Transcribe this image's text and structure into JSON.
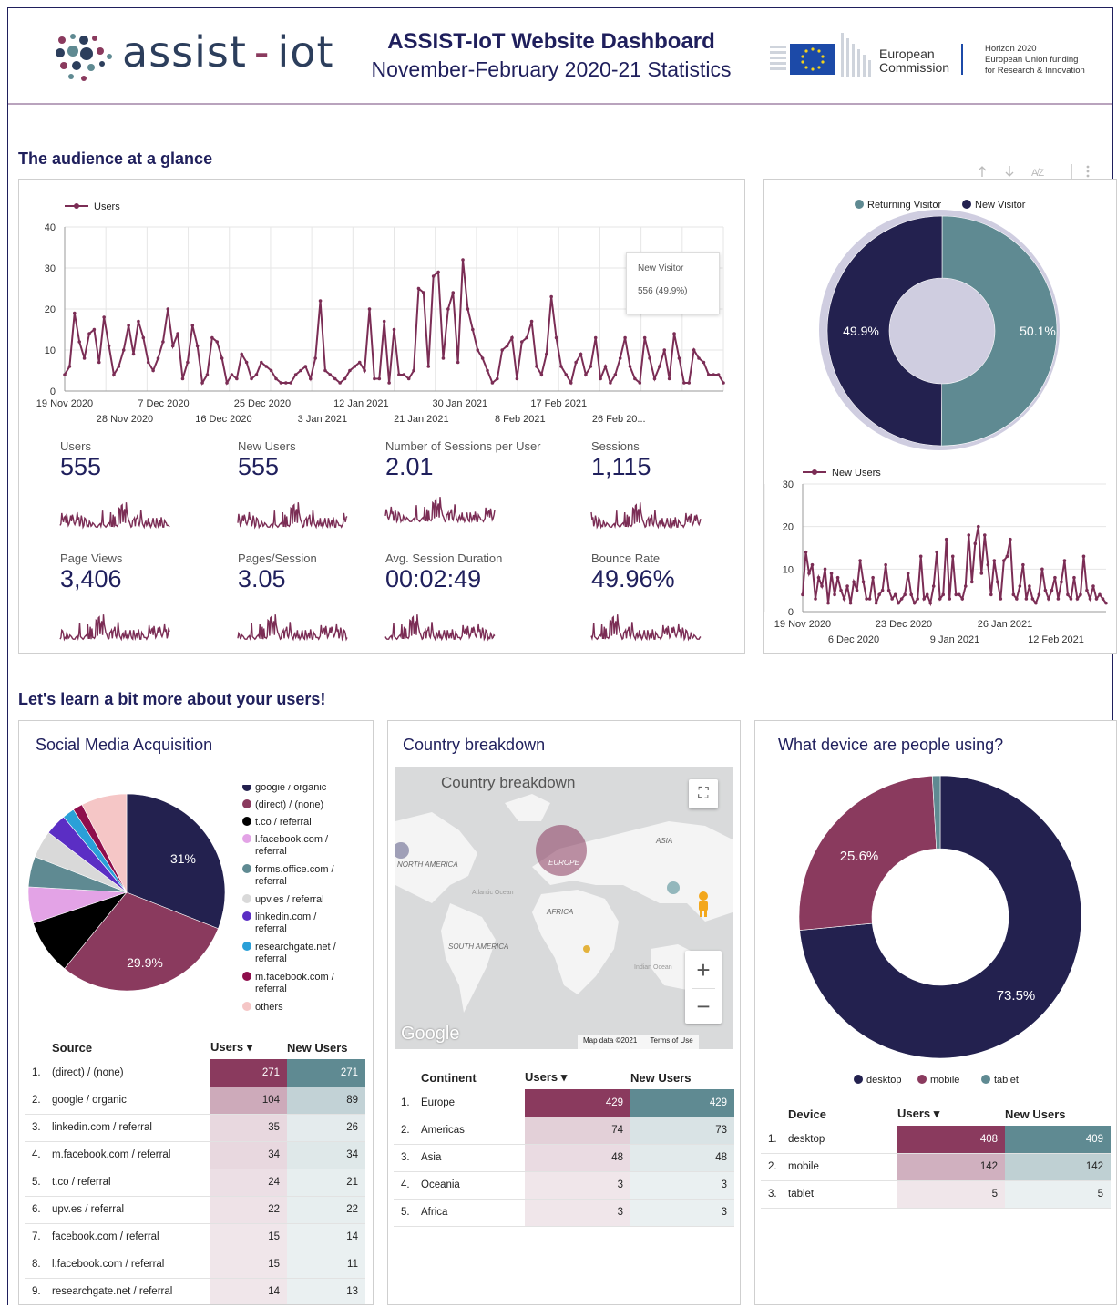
{
  "header": {
    "logo_text_main": "assist",
    "logo_dash": "-",
    "logo_text_end": "iot",
    "title": "ASSIST-IoT Website Dashboard",
    "subtitle": "November-February 2020-21 Statistics",
    "ec_line1": "European",
    "ec_line2": "Commission",
    "horizon_line1": "Horizon 2020",
    "horizon_line2": "European Union funding",
    "horizon_line3": "for Research & Innovation"
  },
  "section1": {
    "title": "The audience at a glance"
  },
  "section2": {
    "title": "Let's learn a bit more about your users!"
  },
  "users_chart": {
    "legend": "Users",
    "tooltip_title": "New Visitor",
    "tooltip_value": "556 (49.9%)",
    "x_ticks_top": [
      "19 Nov 2020",
      "7 Dec 2020",
      "25 Dec 2020",
      "12 Jan 2021",
      "30 Jan 2021",
      "17 Feb 2021"
    ],
    "x_ticks_bottom": [
      "28 Nov 2020",
      "16 Dec 2020",
      "3 Jan 2021",
      "21 Jan 2021",
      "8 Feb 2021",
      "26 Feb 20..."
    ],
    "y_ticks": [
      "0",
      "10",
      "20",
      "30",
      "40"
    ]
  },
  "kpis": [
    {
      "label": "Users",
      "value": "555"
    },
    {
      "label": "New Users",
      "value": "555"
    },
    {
      "label": "Number of Sessions per User",
      "value": "2.01"
    },
    {
      "label": "Sessions",
      "value": "1,115"
    },
    {
      "label": "Page Views",
      "value": "3,406"
    },
    {
      "label": "Pages/Session",
      "value": "3.05"
    },
    {
      "label": "Avg. Session Duration",
      "value": "00:02:49"
    },
    {
      "label": "Bounce Rate",
      "value": "49.96%"
    }
  ],
  "visitor_donut": {
    "legend": [
      "Returning Visitor",
      "New Visitor"
    ],
    "colors": [
      "#5f8a92",
      "#23214f"
    ],
    "values": [
      50.1,
      49.9
    ],
    "labels": [
      "50.1%",
      "49.9%"
    ]
  },
  "new_users_chart": {
    "legend": "New Users",
    "y_ticks": [
      "0",
      "10",
      "20",
      "30"
    ],
    "x_ticks_top": [
      "19 Nov 2020",
      "23 Dec 2020",
      "26 Jan 2021"
    ],
    "x_ticks_bottom": [
      "6 Dec 2020",
      "9 Jan 2021",
      "12 Feb 2021"
    ]
  },
  "social": {
    "title": "Social Media Acquisition",
    "pie_labels": [
      "31%",
      "29.9%"
    ],
    "legend": [
      {
        "label": "google / organic",
        "color": "#23214f"
      },
      {
        "label": "(direct) / (none)",
        "color": "#8a3a5e"
      },
      {
        "label": "t.co / referral",
        "color": "#000000"
      },
      {
        "label": "l.facebook.com / referral",
        "color": "#e3a3e6"
      },
      {
        "label": "forms.office.com / referral",
        "color": "#5f8a92"
      },
      {
        "label": "upv.es / referral",
        "color": "#d9d9d9"
      },
      {
        "label": "linkedin.com / referral",
        "color": "#5b2ec4"
      },
      {
        "label": "researchgate.net / referral",
        "color": "#2aa0d8"
      },
      {
        "label": "m.facebook.com / referral",
        "color": "#8e0e4c"
      },
      {
        "label": "others",
        "color": "#f5c6c6"
      }
    ],
    "table_headers": [
      "Source",
      "Users ▾",
      "New Users"
    ],
    "rows": [
      [
        "1.",
        "(direct) / (none)",
        "271",
        "271"
      ],
      [
        "2.",
        "google / organic",
        "104",
        "89"
      ],
      [
        "3.",
        "linkedin.com / referral",
        "35",
        "26"
      ],
      [
        "4.",
        "m.facebook.com / referral",
        "34",
        "34"
      ],
      [
        "5.",
        "t.co / referral",
        "24",
        "21"
      ],
      [
        "6.",
        "upv.es / referral",
        "22",
        "22"
      ],
      [
        "7.",
        "facebook.com / referral",
        "15",
        "14"
      ],
      [
        "8.",
        "l.facebook.com / referral",
        "15",
        "11"
      ],
      [
        "9.",
        "researchgate.net / referral",
        "14",
        "13"
      ]
    ]
  },
  "country": {
    "title": "Country breakdown",
    "map_title": "Country breakdown",
    "map_labels": [
      "EUROPE",
      "ASIA",
      "AFRICA",
      "SOUTH AMERICA",
      "NORTH AMERICA",
      "Atlantic Ocean",
      "Indian Ocean"
    ],
    "google": "Google",
    "map_data": "Map data ©2021",
    "terms": "Terms of Use",
    "table_headers": [
      "Continent",
      "Users ▾",
      "New Users"
    ],
    "rows": [
      [
        "1.",
        "Europe",
        "429",
        "429"
      ],
      [
        "2.",
        "Americas",
        "74",
        "73"
      ],
      [
        "3.",
        "Asia",
        "48",
        "48"
      ],
      [
        "4.",
        "Oceania",
        "3",
        "3"
      ],
      [
        "5.",
        "Africa",
        "3",
        "3"
      ]
    ]
  },
  "device": {
    "title": "What device are people using?",
    "donut_labels": [
      "73.5%",
      "25.6%"
    ],
    "legend": [
      {
        "label": "desktop",
        "color": "#23214f"
      },
      {
        "label": "mobile",
        "color": "#8a3a5e"
      },
      {
        "label": "tablet",
        "color": "#5f8a92"
      }
    ],
    "table_headers": [
      "Device",
      "Users ▾",
      "New Users"
    ],
    "rows": [
      [
        "1.",
        "desktop",
        "408",
        "409"
      ],
      [
        "2.",
        "mobile",
        "142",
        "142"
      ],
      [
        "3.",
        "tablet",
        "5",
        "5"
      ]
    ]
  },
  "chart_data": [
    {
      "type": "line",
      "series": [
        {
          "name": "Users",
          "values": [
            4,
            6,
            19,
            12,
            8,
            14,
            15,
            7,
            18,
            11,
            4,
            6,
            10,
            16,
            9,
            17,
            13,
            7,
            5,
            8,
            12,
            20,
            11,
            14,
            3,
            7,
            16,
            11,
            2,
            4,
            13,
            12,
            8,
            2,
            4,
            3,
            9,
            7,
            3,
            4,
            7,
            6,
            5,
            3,
            2,
            2,
            2,
            4,
            5,
            6,
            3,
            8,
            22,
            5,
            4,
            3,
            2,
            3,
            5,
            6,
            7,
            5,
            20,
            3,
            3,
            17,
            2,
            15,
            4,
            4,
            3,
            5,
            25,
            24,
            6,
            28,
            29,
            8,
            20,
            24,
            7,
            32,
            20,
            15,
            10,
            8,
            5,
            2,
            3,
            10,
            11,
            13,
            3,
            12,
            13,
            17,
            6,
            4,
            9,
            23,
            13,
            6,
            4,
            2,
            7,
            9,
            4,
            6,
            13,
            3,
            6,
            2,
            4,
            8,
            13,
            6,
            3,
            2,
            13,
            8,
            3,
            6,
            10,
            3,
            14,
            8,
            2,
            2,
            10,
            8,
            7,
            4,
            4,
            4,
            2
          ],
          "color": "#7b2d55"
        }
      ],
      "ylim": [
        0,
        40
      ],
      "x_ticks": [
        "19 Nov 2020",
        "28 Nov 2020",
        "7 Dec 2020",
        "16 Dec 2020",
        "25 Dec 2020",
        "3 Jan 2021",
        "12 Jan 2021",
        "21 Jan 2021",
        "30 Jan 2021",
        "8 Feb 2021",
        "17 Feb 2021",
        "26 Feb 20..."
      ],
      "legend": "Users"
    },
    {
      "type": "pie",
      "title": "",
      "labels": [
        "Returning Visitor",
        "New Visitor"
      ],
      "values": [
        50.1,
        49.9
      ]
    },
    {
      "type": "line",
      "series": [
        {
          "name": "New Users",
          "values": [
            4,
            14,
            9,
            11,
            3,
            8,
            6,
            10,
            2,
            9,
            4,
            8,
            5,
            3,
            6,
            2,
            7,
            5,
            12,
            7,
            3,
            3,
            8,
            2,
            4,
            5,
            11,
            5,
            3,
            4,
            2,
            3,
            4,
            9,
            4,
            2,
            3,
            13,
            3,
            4,
            2,
            6,
            14,
            3,
            4,
            17,
            3,
            13,
            4,
            4,
            3,
            6,
            18,
            7,
            16,
            20,
            9,
            18,
            11,
            4,
            12,
            7,
            3,
            12,
            13,
            17,
            4,
            3,
            6,
            11,
            3,
            6,
            3,
            2,
            4,
            10,
            5,
            3,
            5,
            8,
            3,
            7,
            12,
            4,
            3,
            8,
            3,
            4,
            13,
            5,
            3,
            6,
            3,
            4,
            3,
            2
          ],
          "color": "#7b2d55"
        }
      ],
      "ylim": [
        0,
        30
      ],
      "legend": "New Users"
    },
    {
      "type": "pie",
      "title": "Social Media Acquisition",
      "labels": [
        "google / organic",
        "(direct) / (none)",
        "t.co / referral",
        "l.facebook.com / referral",
        "forms.office.com / referral",
        "upv.es / referral",
        "linkedin.com / referral",
        "researchgate.net / referral",
        "m.facebook.com / referral",
        "others"
      ],
      "values": [
        31,
        29.9,
        9,
        6,
        5,
        4.5,
        3.5,
        2,
        1.6,
        7.5
      ]
    },
    {
      "type": "pie",
      "title": "What device are people using?",
      "labels": [
        "desktop",
        "mobile",
        "tablet"
      ],
      "values": [
        73.5,
        25.6,
        0.9
      ]
    }
  ]
}
